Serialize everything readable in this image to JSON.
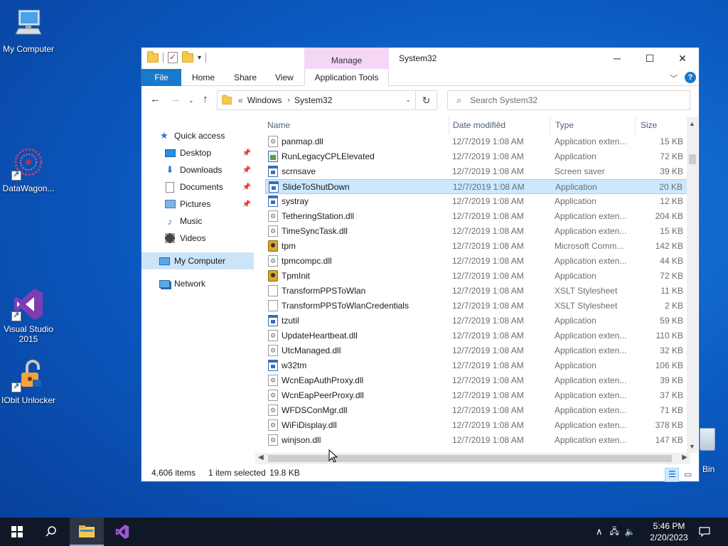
{
  "desktop": {
    "icons": [
      {
        "label": "My Computer"
      },
      {
        "label": "DataWagon..."
      },
      {
        "label": "Visual Studio 2015"
      },
      {
        "label": "IObit Unlocker"
      }
    ],
    "recycle_bin_label_partial": "Bin"
  },
  "window": {
    "title": "System32",
    "context_tab": "Manage",
    "ribbon_tabs": [
      "File",
      "Home",
      "Share",
      "View",
      "Application Tools"
    ],
    "address": {
      "crumbs": [
        "Windows",
        "System32"
      ],
      "prefix": "«"
    },
    "search_placeholder": "Search System32",
    "nav": [
      {
        "label": "Quick access",
        "icon": "star-icon",
        "pinned": false
      },
      {
        "label": "Desktop",
        "icon": "desktop-icon",
        "pinned": true
      },
      {
        "label": "Downloads",
        "icon": "download-icon",
        "pinned": true
      },
      {
        "label": "Documents",
        "icon": "documents-icon",
        "pinned": true
      },
      {
        "label": "Pictures",
        "icon": "pictures-icon",
        "pinned": true
      },
      {
        "label": "Music",
        "icon": "music-icon",
        "pinned": false
      },
      {
        "label": "Videos",
        "icon": "videos-icon",
        "pinned": false
      },
      {
        "label": "My Computer",
        "icon": "computer-icon",
        "pinned": false,
        "selected": true
      },
      {
        "label": "Network",
        "icon": "network-icon",
        "pinned": false
      }
    ],
    "columns": {
      "name": "Name",
      "date": "Date modified",
      "type": "Type",
      "size": "Size"
    },
    "files": [
      {
        "name": "panmap.dll",
        "date": "12/7/2019 1:08 AM",
        "type": "Application exten...",
        "size": "15 KB",
        "icon": "dll"
      },
      {
        "name": "RunLegacyCPLElevated",
        "date": "12/7/2019 1:08 AM",
        "type": "Application",
        "size": "72 KB",
        "icon": "legacy"
      },
      {
        "name": "scrnsave",
        "date": "12/7/2019 1:08 AM",
        "type": "Screen saver",
        "size": "39 KB",
        "icon": "app"
      },
      {
        "name": "SlideToShutDown",
        "date": "12/7/2019 1:08 AM",
        "type": "Application",
        "size": "20 KB",
        "icon": "app",
        "selected": true
      },
      {
        "name": "systray",
        "date": "12/7/2019 1:08 AM",
        "type": "Application",
        "size": "12 KB",
        "icon": "app"
      },
      {
        "name": "TetheringStation.dll",
        "date": "12/7/2019 1:08 AM",
        "type": "Application exten...",
        "size": "204 KB",
        "icon": "dll"
      },
      {
        "name": "TimeSyncTask.dll",
        "date": "12/7/2019 1:08 AM",
        "type": "Application exten...",
        "size": "15 KB",
        "icon": "dll"
      },
      {
        "name": "tpm",
        "date": "12/7/2019 1:08 AM",
        "type": "Microsoft Comm...",
        "size": "142 KB",
        "icon": "tpm"
      },
      {
        "name": "tpmcompc.dll",
        "date": "12/7/2019 1:08 AM",
        "type": "Application exten...",
        "size": "44 KB",
        "icon": "dll"
      },
      {
        "name": "TpmInit",
        "date": "12/7/2019 1:08 AM",
        "type": "Application",
        "size": "72 KB",
        "icon": "tpm"
      },
      {
        "name": "TransformPPSToWlan",
        "date": "12/7/2019 1:08 AM",
        "type": "XSLT Stylesheet",
        "size": "11 KB",
        "icon": "doc"
      },
      {
        "name": "TransformPPSToWlanCredentials",
        "date": "12/7/2019 1:08 AM",
        "type": "XSLT Stylesheet",
        "size": "2 KB",
        "icon": "doc"
      },
      {
        "name": "tzutil",
        "date": "12/7/2019 1:08 AM",
        "type": "Application",
        "size": "59 KB",
        "icon": "app"
      },
      {
        "name": "UpdateHeartbeat.dll",
        "date": "12/7/2019 1:08 AM",
        "type": "Application exten...",
        "size": "110 KB",
        "icon": "dll"
      },
      {
        "name": "UtcManaged.dll",
        "date": "12/7/2019 1:08 AM",
        "type": "Application exten...",
        "size": "32 KB",
        "icon": "dll"
      },
      {
        "name": "w32tm",
        "date": "12/7/2019 1:08 AM",
        "type": "Application",
        "size": "106 KB",
        "icon": "app"
      },
      {
        "name": "WcnEapAuthProxy.dll",
        "date": "12/7/2019 1:08 AM",
        "type": "Application exten...",
        "size": "39 KB",
        "icon": "dll"
      },
      {
        "name": "WcnEapPeerProxy.dll",
        "date": "12/7/2019 1:08 AM",
        "type": "Application exten...",
        "size": "37 KB",
        "icon": "dll"
      },
      {
        "name": "WFDSConMgr.dll",
        "date": "12/7/2019 1:08 AM",
        "type": "Application exten...",
        "size": "71 KB",
        "icon": "dll"
      },
      {
        "name": "WiFiDisplay.dll",
        "date": "12/7/2019 1:08 AM",
        "type": "Application exten...",
        "size": "378 KB",
        "icon": "dll"
      },
      {
        "name": "winjson.dll",
        "date": "12/7/2019 1:08 AM",
        "type": "Application exten...",
        "size": "147 KB",
        "icon": "dll"
      }
    ],
    "status": {
      "items": "4,606 items",
      "selected": "1 item selected",
      "size": "19.8 KB"
    }
  },
  "taskbar": {
    "time": "5:46 PM",
    "date": "2/20/2023"
  },
  "colors": {
    "accent": "#1979ca",
    "selection": "#cce8ff",
    "taskbar": "#101827"
  }
}
